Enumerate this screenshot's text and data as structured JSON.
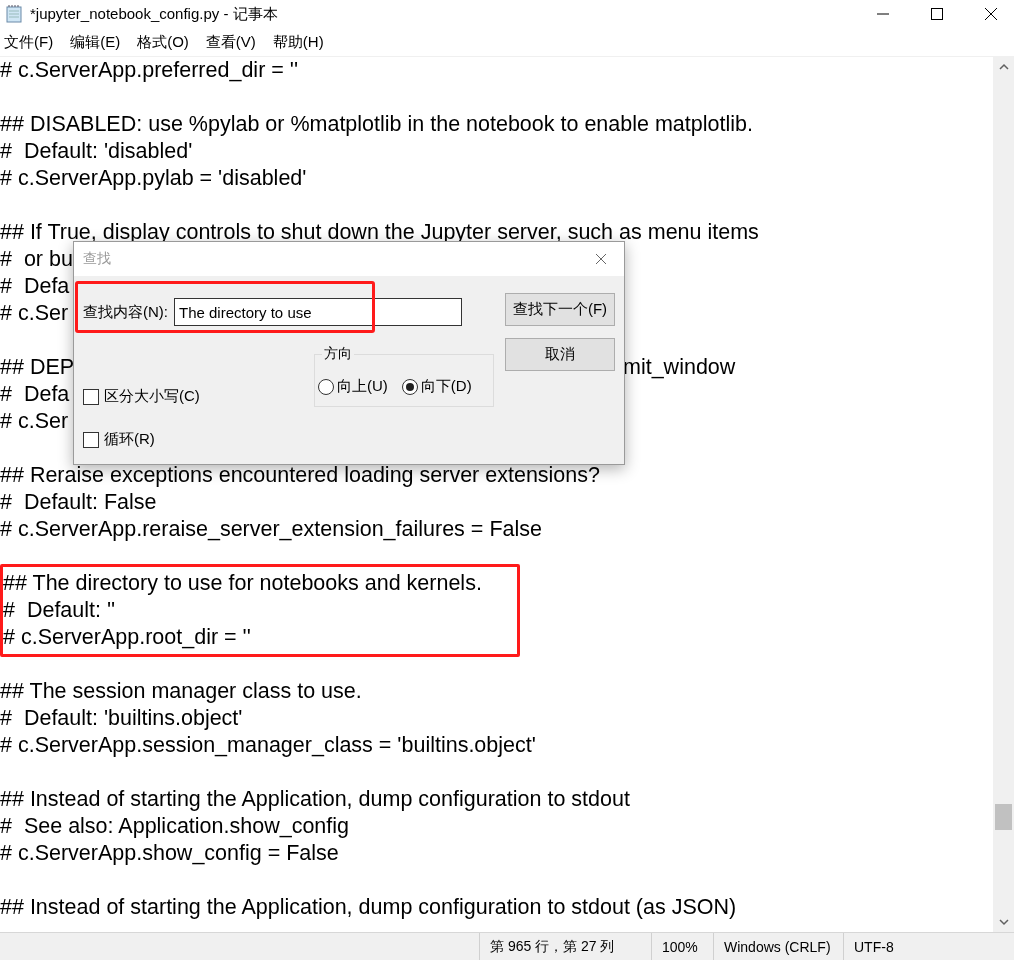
{
  "window": {
    "title": "*jupyter_notebook_config.py - 记事本"
  },
  "menu": [
    "文件(F)",
    "编辑(E)",
    "格式(O)",
    "查看(V)",
    "帮助(H)"
  ],
  "editor": {
    "blocks": [
      {
        "highlighted": false,
        "lines": [
          {
            "text": "# c.ServerApp.preferred_dir = ''"
          }
        ]
      },
      {
        "highlighted": false,
        "lines": [
          {
            "text": "## DISABLED: use %pylab or %matplotlib in the notebook to enable matplotlib."
          },
          {
            "text": "#  Default: 'disabled'"
          },
          {
            "text": "# c.ServerApp.pylab = 'disabled'"
          }
        ]
      },
      {
        "highlighted": false,
        "lines": [
          {
            "text": "## If True, display controls to shut down the Jupyter server, such as menu items"
          },
          {
            "text": "#  or bu"
          },
          {
            "text": "#  Defa"
          },
          {
            "text": "# c.Ser"
          }
        ]
      },
      {
        "highlighted": false,
        "lines": [
          {
            "text": "## DEP",
            "tail": "mit_window"
          },
          {
            "text": "#  Defa"
          },
          {
            "text": "# c.Ser"
          }
        ]
      },
      {
        "highlighted": false,
        "lines": [
          {
            "text": "## Reraise exceptions encountered loading server extensions?"
          },
          {
            "text": "#  Default: False"
          },
          {
            "text": "# c.ServerApp.reraise_server_extension_failures = False"
          }
        ]
      },
      {
        "highlighted": true,
        "lines": [
          {
            "text": "## The directory to use for notebooks and kernels."
          },
          {
            "text": "#  Default: ''"
          },
          {
            "text": "# c.ServerApp.root_dir = ''"
          }
        ]
      },
      {
        "highlighted": false,
        "lines": [
          {
            "text": "## The session manager class to use."
          },
          {
            "text": "#  Default: 'builtins.object'"
          },
          {
            "text": "# c.ServerApp.session_manager_class = 'builtins.object'"
          }
        ]
      },
      {
        "highlighted": false,
        "lines": [
          {
            "text": "## Instead of starting the Application, dump configuration to stdout"
          },
          {
            "text": "#  See also: Application.show_config"
          },
          {
            "text": "# c.ServerApp.show_config = False"
          }
        ]
      },
      {
        "highlighted": false,
        "lines": [
          {
            "text": "## Instead of starting the Application, dump configuration to stdout (as JSON)"
          }
        ]
      }
    ]
  },
  "find_dialog": {
    "title": "查找",
    "find_what": {
      "label": "查找内容(N):",
      "value": "The directory to use",
      "highlighted": true
    },
    "buttons": [
      "查找下一个(F)",
      "取消"
    ],
    "direction": {
      "label": "方向",
      "options": [
        {
          "label": "向上(U)",
          "selected": false
        },
        {
          "label": "向下(D)",
          "selected": true
        }
      ]
    },
    "checkboxes": [
      {
        "label": "区分大小写(C)",
        "checked": false
      },
      {
        "label": "循环(R)",
        "checked": false
      }
    ]
  },
  "status_bar": [
    "第 965 行，第 27 列",
    "100%",
    "Windows (CRLF)",
    "UTF-8"
  ]
}
